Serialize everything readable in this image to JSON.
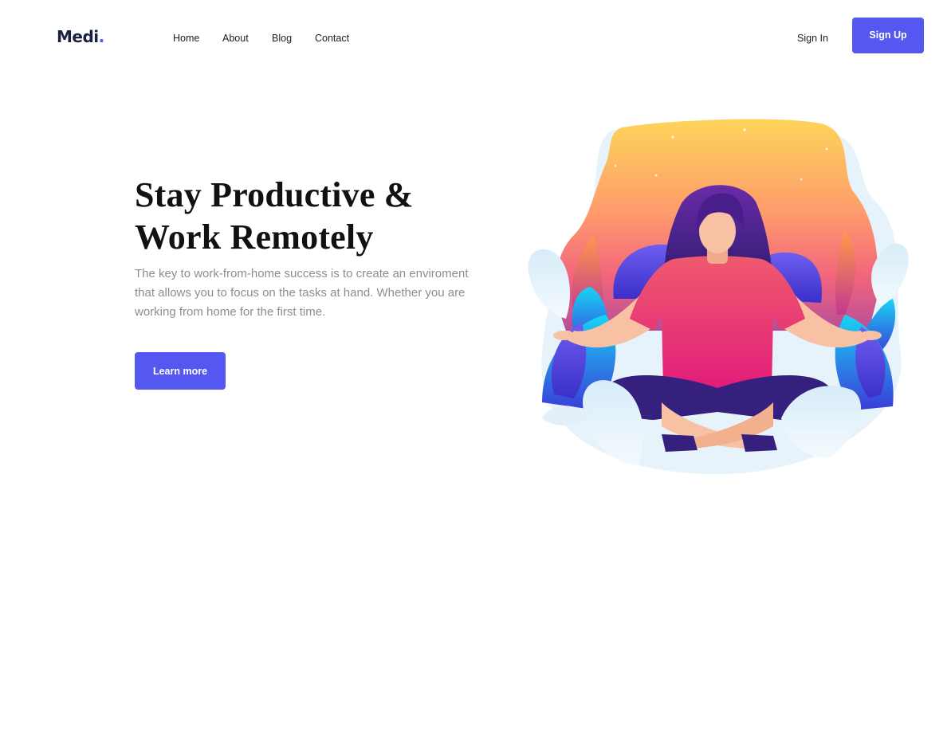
{
  "header": {
    "logo": {
      "text": "Medi",
      "dot": "."
    },
    "nav": [
      {
        "label": "Home"
      },
      {
        "label": "About"
      },
      {
        "label": "Blog"
      },
      {
        "label": "Contact"
      }
    ],
    "sign_in": "Sign In",
    "sign_up": "Sign Up"
  },
  "hero": {
    "title_line1": "Stay Productive &",
    "title_line2": "Work Remotely",
    "description": "The key to work-from-home success is to create an enviroment that allows you to focus on the tasks at hand. Whether you are working from home for the first time.",
    "cta": "Learn more"
  },
  "colors": {
    "accent": "#5458f0",
    "heading": "#111111",
    "body_text": "#8d8d93",
    "logo_text": "#1b2040"
  },
  "icons": {
    "illustration": "meditating-woman-illustration"
  }
}
